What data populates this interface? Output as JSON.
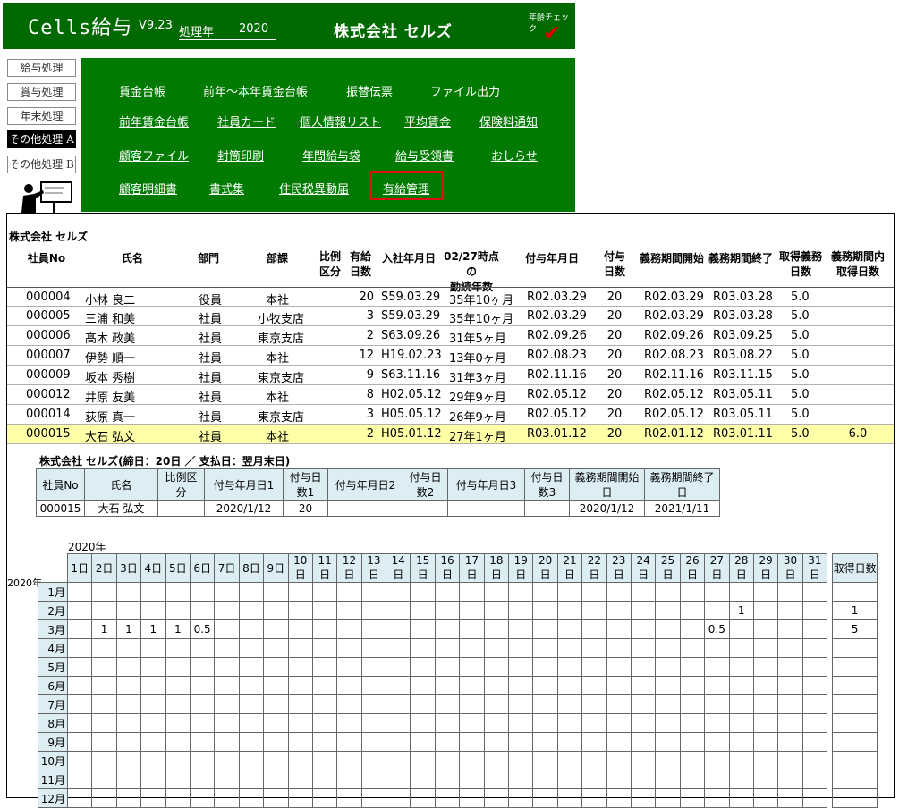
{
  "titlebar": {
    "app_name": "Cells給与",
    "version": "V9.23",
    "year_label": "処理年",
    "year_value": "2020",
    "company": "株式会社 セルズ",
    "age_check": "年齢チェック",
    "check_mark": "✔"
  },
  "left_menu": [
    "給与処理",
    "賞与処理",
    "年末処理",
    "その他処理 A",
    "その他処理 B"
  ],
  "menu_items": [
    [
      "賃金台帳",
      "前年～本年賃金台帳",
      "振替伝票",
      "ファイル出力"
    ],
    [
      "前年賃金台帳",
      "社員カード",
      "個人情報リスト",
      "平均賃金",
      "保険料通知"
    ],
    [
      "顧客ファイル",
      "封筒印刷",
      "年間給与袋",
      "給与受領書",
      "おしらせ"
    ],
    [
      "顧客明細書",
      "書式集",
      "住民税異動届",
      "有給管理"
    ]
  ],
  "sheet": {
    "company": "株式会社 セルズ",
    "headers": {
      "emp_no": "社員No",
      "name": "氏名",
      "dept": "部門",
      "section": "部課",
      "prorate_1": "比例",
      "prorate_2": "区分",
      "paid_1": "有給",
      "paid_2": "日数",
      "joined": "入社年月日",
      "tenure_1": "02/27時点の",
      "tenure_2": "勤続年数",
      "grant_date": "付与年月日",
      "grant_days_1": "付与",
      "grant_days_2": "日数",
      "period_start": "義務期間開始",
      "period_end": "義務期間終了",
      "obligation_1": "取得義務",
      "obligation_2": "日数",
      "taken_1": "義務期間内",
      "taken_2": "取得日数"
    },
    "rows": [
      {
        "no": "000004",
        "name": "小林 良二",
        "dept": "役員",
        "section": "本社",
        "prorate": "",
        "paid": "20",
        "joined": "S59.03.29",
        "tenure": "35年10ヶ月",
        "grant": "R02.03.29",
        "gdays": "20",
        "pstart": "R02.03.29",
        "pend": "R03.03.28",
        "oblig": "5.0",
        "taken": ""
      },
      {
        "no": "000005",
        "name": "三浦 和美",
        "dept": "社員",
        "section": "小牧支店",
        "prorate": "",
        "paid": "3",
        "joined": "S59.03.29",
        "tenure": "35年10ヶ月",
        "grant": "R02.03.29",
        "gdays": "20",
        "pstart": "R02.03.29",
        "pend": "R03.03.28",
        "oblig": "5.0",
        "taken": ""
      },
      {
        "no": "000006",
        "name": "髙木 政美",
        "dept": "社員",
        "section": "東京支店",
        "prorate": "",
        "paid": "2",
        "joined": "S63.09.26",
        "tenure": "31年5ヶ月",
        "grant": "R02.09.26",
        "gdays": "20",
        "pstart": "R02.09.26",
        "pend": "R03.09.25",
        "oblig": "5.0",
        "taken": ""
      },
      {
        "no": "000007",
        "name": "伊勢 順一",
        "dept": "社員",
        "section": "本社",
        "prorate": "",
        "paid": "12",
        "joined": "H19.02.23",
        "tenure": "13年0ヶ月",
        "grant": "R02.08.23",
        "gdays": "20",
        "pstart": "R02.08.23",
        "pend": "R03.08.22",
        "oblig": "5.0",
        "taken": ""
      },
      {
        "no": "000009",
        "name": "坂本 秀樹",
        "dept": "社員",
        "section": "東京支店",
        "prorate": "",
        "paid": "9",
        "joined": "S63.11.16",
        "tenure": "31年3ヶ月",
        "grant": "R02.11.16",
        "gdays": "20",
        "pstart": "R02.11.16",
        "pend": "R03.11.15",
        "oblig": "5.0",
        "taken": ""
      },
      {
        "no": "000012",
        "name": "井原 友美",
        "dept": "社員",
        "section": "本社",
        "prorate": "",
        "paid": "8",
        "joined": "H02.05.12",
        "tenure": "29年9ヶ月",
        "grant": "R02.05.12",
        "gdays": "20",
        "pstart": "R02.05.12",
        "pend": "R03.05.11",
        "oblig": "5.0",
        "taken": ""
      },
      {
        "no": "000014",
        "name": "荻原 真一",
        "dept": "社員",
        "section": "東京支店",
        "prorate": "",
        "paid": "3",
        "joined": "H05.05.12",
        "tenure": "26年9ヶ月",
        "grant": "R02.05.12",
        "gdays": "20",
        "pstart": "R02.05.12",
        "pend": "R03.05.11",
        "oblig": "5.0",
        "taken": ""
      },
      {
        "no": "000015",
        "name": "大石 弘文",
        "dept": "社員",
        "section": "本社",
        "prorate": "",
        "paid": "2",
        "joined": "H05.01.12",
        "tenure": "27年1ヶ月",
        "grant": "R03.01.12",
        "gdays": "20",
        "pstart": "R02.01.12",
        "pend": "R03.01.11",
        "oblig": "5.0",
        "taken": "6.0"
      }
    ],
    "highlight_color": "#ffffa8"
  },
  "detail": {
    "title": "株式会社 セルズ(締日：20日 ／ 支払日：翌月末日)",
    "headers": [
      "社員No",
      "氏名",
      "比例区分",
      "付与年月日1",
      "付与日数1",
      "付与年月日2",
      "付与日数2",
      "付与年月日3",
      "付与日数3",
      "義務期間開始日",
      "義務期間終了日"
    ],
    "values": [
      "000015",
      "大石 弘文",
      "",
      "2020/1/12",
      "20",
      "",
      "",
      "",
      "",
      "2020/1/12",
      "2021/1/11"
    ]
  },
  "calendar": {
    "year_top": "2020年",
    "year_side": "2020年",
    "days": [
      "1日",
      "2日",
      "3日",
      "4日",
      "5日",
      "6日",
      "7日",
      "8日",
      "9日",
      "10日",
      "11日",
      "12日",
      "13日",
      "14日",
      "15日",
      "16日",
      "17日",
      "18日",
      "19日",
      "20日",
      "21日",
      "22日",
      "23日",
      "24日",
      "25日",
      "26日",
      "27日",
      "28日",
      "29日",
      "30日",
      "31日"
    ],
    "total_label": "取得日数",
    "months": [
      {
        "label": "1月",
        "days": [],
        "total": ""
      },
      {
        "label": "2月",
        "days": [
          [
            28,
            "1"
          ]
        ],
        "total": "1"
      },
      {
        "label": "3月",
        "days": [
          [
            2,
            "1"
          ],
          [
            3,
            "1"
          ],
          [
            4,
            "1"
          ],
          [
            5,
            "1"
          ],
          [
            6,
            "0.5"
          ],
          [
            27,
            "0.5"
          ]
        ],
        "total": "5"
      },
      {
        "label": "4月",
        "days": [],
        "total": ""
      },
      {
        "label": "5月",
        "days": [],
        "total": ""
      },
      {
        "label": "6月",
        "days": [],
        "total": ""
      },
      {
        "label": "7月",
        "days": [],
        "total": ""
      },
      {
        "label": "8月",
        "days": [],
        "total": ""
      },
      {
        "label": "9月",
        "days": [],
        "total": ""
      },
      {
        "label": "10月",
        "days": [],
        "total": ""
      },
      {
        "label": "11月",
        "days": [],
        "total": ""
      },
      {
        "label": "12月",
        "days": [],
        "total": ""
      }
    ]
  },
  "colors": {
    "titlebar_bg": "#006a00",
    "menu_bg": "#007a00",
    "highlight_border": "#e01010",
    "header_cell_bg": "#dcedf4"
  },
  "icons": {
    "presenter": "presenter-figure-icon",
    "check": "red-check-icon"
  }
}
